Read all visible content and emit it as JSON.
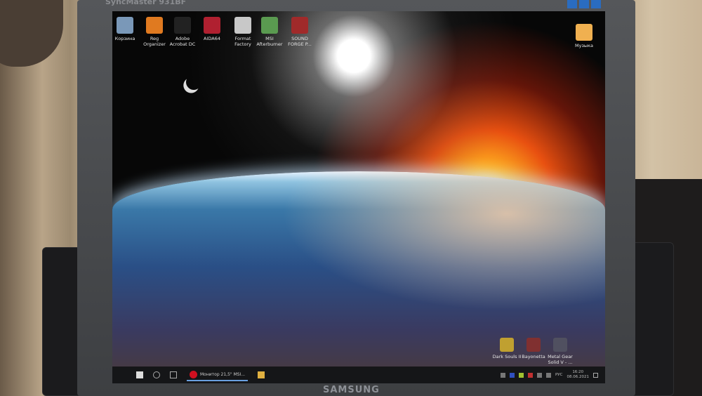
{
  "monitor": {
    "model": "SyncMaster 931BF",
    "brand": "SAMSUNG"
  },
  "desktop_icons": [
    {
      "label": "Корзина",
      "icon": "recycle-bin-icon",
      "color": "#7a98b8"
    },
    {
      "label": "Reg Organizer",
      "icon": "reg-organizer-icon",
      "color": "#e07a20"
    },
    {
      "label": "Adobe Acrobat DC",
      "icon": "acrobat-icon",
      "color": "#222222"
    },
    {
      "label": "AIDA64",
      "icon": "aida64-icon",
      "color": "#b02030"
    },
    {
      "label": "Format Factory",
      "icon": "format-factory-icon",
      "color": "#c8c8c8"
    },
    {
      "label": "MSI Afterburner",
      "icon": "msi-afterburner-icon",
      "color": "#5a9a50"
    },
    {
      "label": "SOUND FORGE P...",
      "icon": "sound-forge-icon",
      "color": "#a02a2a"
    },
    {
      "label": "Музыка",
      "icon": "folder-music-icon",
      "color": "#f0b050"
    }
  ],
  "game_icons": [
    {
      "label": "Dark Souls II",
      "icon": "dark-souls-icon",
      "color": "#c0a030"
    },
    {
      "label": "Bayonetta",
      "icon": "bayonetta-icon",
      "color": "#803030"
    },
    {
      "label": "Metal Gear Solid V - ...",
      "icon": "mgs-icon",
      "color": "#505060"
    }
  ],
  "taskbar": {
    "opera_window": "Монитор 21,5\" MSI...",
    "lang": "РУС",
    "time": "16:20",
    "date": "08.06.2021"
  }
}
